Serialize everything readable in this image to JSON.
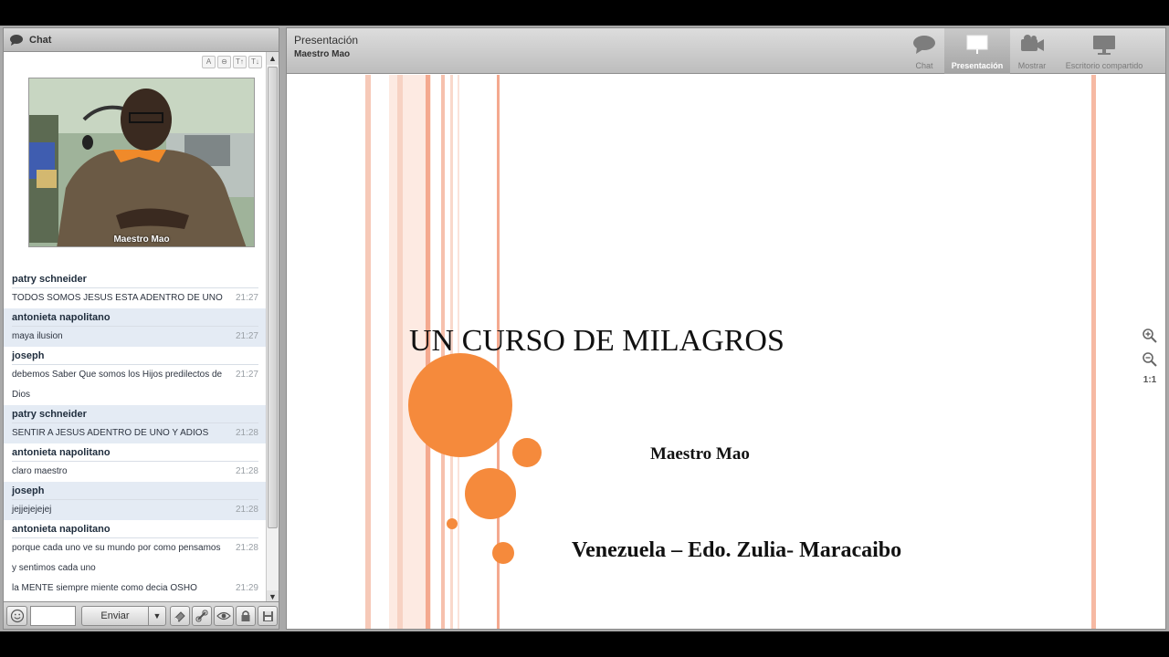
{
  "chat": {
    "header_title": "Chat",
    "video_caption": "Maestro Mao",
    "font_tools": [
      "A",
      "⊖",
      "T↑",
      "T↓"
    ],
    "messages": [
      {
        "name": "patry schneider",
        "lines": [
          {
            "text": "TODOS SOMOS JESUS ESTA ADENTRO DE UNO",
            "time": "21:27"
          }
        ]
      },
      {
        "name": "antonieta napolitano",
        "lines": [
          {
            "text": "maya ilusion",
            "time": "21:27"
          }
        ]
      },
      {
        "name": "joseph",
        "lines": [
          {
            "text": "debemos Saber Que somos los Hijos predilectos de",
            "time": "21:27"
          },
          {
            "text": "Dios",
            "time": ""
          }
        ]
      },
      {
        "name": "patry schneider",
        "lines": [
          {
            "text": "SENTIR A JESUS ADENTRO DE UNO Y ADIOS",
            "time": "21:28"
          }
        ]
      },
      {
        "name": "antonieta napolitano",
        "lines": [
          {
            "text": "claro maestro",
            "time": "21:28"
          }
        ]
      },
      {
        "name": "joseph",
        "lines": [
          {
            "text": "jejjejejejej",
            "time": "21:28"
          }
        ]
      },
      {
        "name": "antonieta napolitano",
        "lines": [
          {
            "text": "porque cada uno ve su mundo por como pensamos",
            "time": "21:28"
          },
          {
            "text": "y sentimos  cada uno",
            "time": ""
          },
          {
            "text": "la  MENTE  siempre miente como decia OSHO",
            "time": "21:29"
          }
        ]
      }
    ],
    "input_value": "",
    "send_label": "Enviar",
    "toolbar_icons": [
      "smiley-icon",
      "eraser-icon",
      "link-icon",
      "eye-icon",
      "lock-icon",
      "save-icon"
    ]
  },
  "presentation": {
    "title": "Presentación",
    "presenter": "Maestro Mao",
    "modes": [
      {
        "label": "Chat",
        "icon": "chat-bubble-icon",
        "active": false
      },
      {
        "label": "Presentación",
        "icon": "projector-screen-icon",
        "active": true
      },
      {
        "label": "Mostrar",
        "icon": "webcam-icon",
        "active": false
      },
      {
        "label": "Escritorio compartido",
        "icon": "monitor-icon",
        "active": false
      }
    ],
    "zoom_level": "1:1",
    "slide": {
      "title": "UN CURSO DE MILAGROS",
      "author": "Maestro Mao",
      "location": "Venezuela – Edo. Zulia- Maracaibo"
    }
  },
  "colors": {
    "accent_orange": "#f58a3c",
    "stripe_pink": "#f6b9a3",
    "chat_alt_row": "#e4ebf4"
  }
}
